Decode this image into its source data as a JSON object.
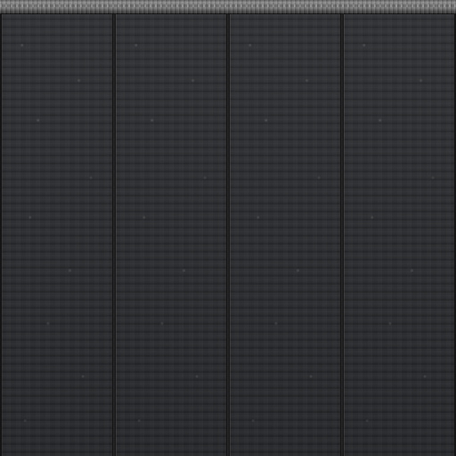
{
  "scene": {
    "description_label": "",
    "panel_count": 4,
    "colors": {
      "trim": "#777777",
      "panel": "#2c2e31",
      "seam": "#111111"
    }
  }
}
